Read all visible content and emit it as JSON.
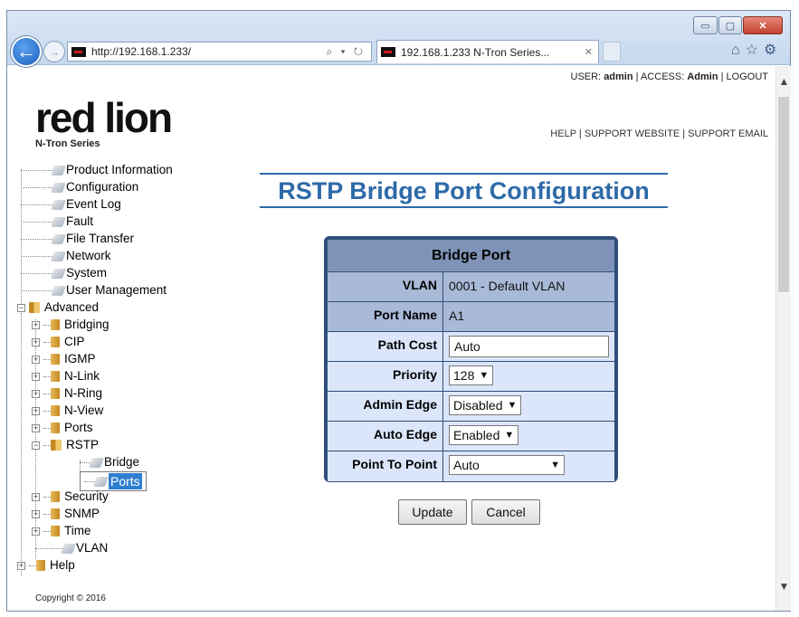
{
  "browser": {
    "url": "http://192.168.1.233/",
    "tab_title": "192.168.1.233 N-Tron Series...",
    "window_controls": {
      "minimize": "▭",
      "maximize": "▢",
      "close": "✕"
    },
    "address_tools": "⌕ ▾ ↻",
    "tab_close": "✕",
    "toolbar_icons": "⌂☆⚙"
  },
  "header": {
    "logo_word": "red lion",
    "logo_sub": "N-Tron Series",
    "user_label": "USER:",
    "user_value": "admin",
    "access_label": "ACCESS:",
    "access_value": "Admin",
    "logout": "LOGOUT",
    "help_links": [
      "HELP",
      "SUPPORT WEBSITE",
      "SUPPORT EMAIL"
    ],
    "separator": "|"
  },
  "nav": {
    "items": [
      {
        "label": "Product Information"
      },
      {
        "label": "Configuration"
      },
      {
        "label": "Event Log"
      },
      {
        "label": "Fault"
      },
      {
        "label": "File Transfer"
      },
      {
        "label": "Network"
      },
      {
        "label": "System"
      },
      {
        "label": "User Management"
      },
      {
        "label": "Advanced"
      },
      {
        "label": "Bridging"
      },
      {
        "label": "CIP"
      },
      {
        "label": "IGMP"
      },
      {
        "label": "N-Link"
      },
      {
        "label": "N-Ring"
      },
      {
        "label": "N-View"
      },
      {
        "label": "Ports"
      },
      {
        "label": "RSTP"
      },
      {
        "label": "Bridge"
      },
      {
        "label": "Ports"
      },
      {
        "label": "Security"
      },
      {
        "label": "SNMP"
      },
      {
        "label": "Time"
      },
      {
        "label": "VLAN"
      },
      {
        "label": "Help"
      }
    ],
    "selected": "Ports",
    "copyright": "Copyright © 2016"
  },
  "main": {
    "title": "RSTP Bridge Port Configuration",
    "panel_title": "Bridge Port",
    "fields": {
      "vlan_label": "VLAN",
      "vlan_value": "0001 - Default VLAN",
      "port_name_label": "Port Name",
      "port_name_value": "A1",
      "path_cost_label": "Path Cost",
      "path_cost_value": "Auto",
      "priority_label": "Priority",
      "priority_value": "128",
      "admin_edge_label": "Admin Edge",
      "admin_edge_value": "Disabled",
      "auto_edge_label": "Auto Edge",
      "auto_edge_value": "Enabled",
      "p2p_label": "Point To Point",
      "p2p_value": "Auto"
    },
    "update_label": "Update",
    "cancel_label": "Cancel"
  }
}
